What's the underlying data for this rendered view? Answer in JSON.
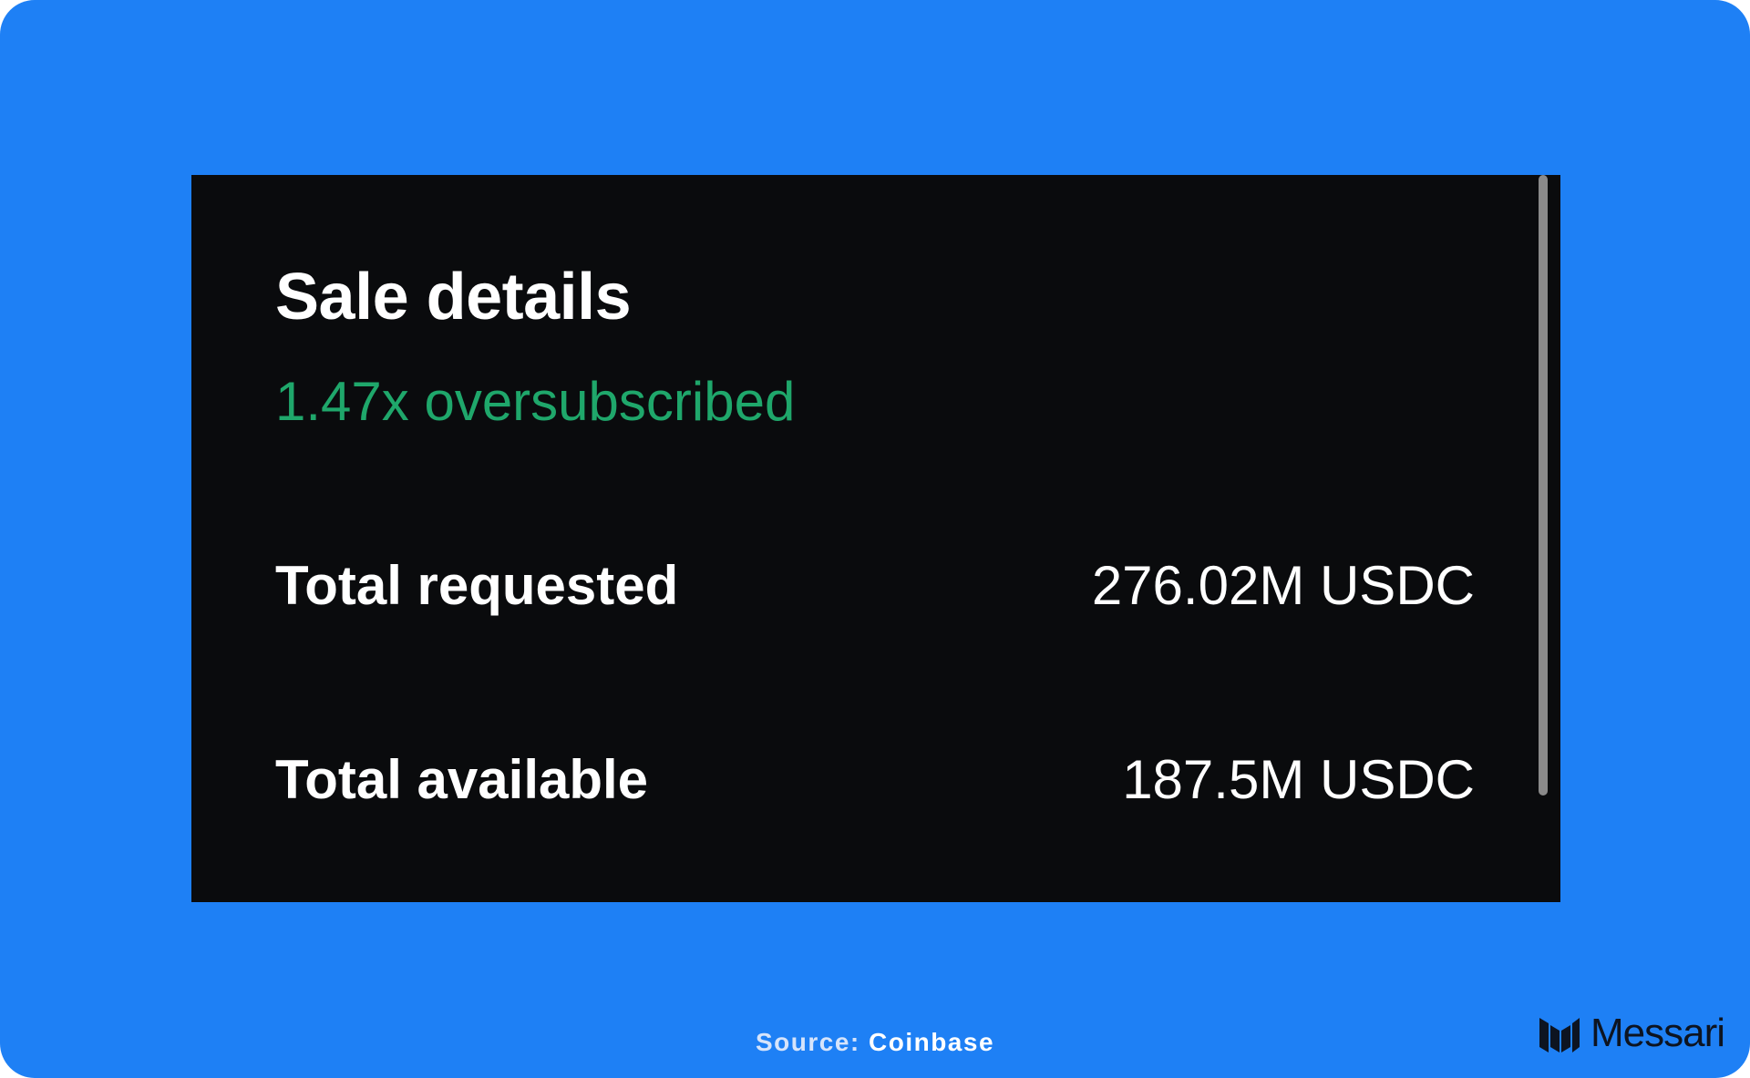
{
  "panel": {
    "title": "Sale details",
    "subtitle": "1.47x oversubscribed",
    "rows": [
      {
        "label": "Total requested",
        "value": "276.02M USDC"
      },
      {
        "label": "Total available",
        "value": "187.5M USDC"
      }
    ]
  },
  "footer": {
    "source_prefix": "Source:",
    "source_name": "Coinbase",
    "brand_name": "Messari"
  },
  "colors": {
    "background": "#1e80f5",
    "panel": "#0a0b0d",
    "accent_green": "#1fa76b",
    "text": "#ffffff",
    "brand_text": "#0d1421"
  },
  "icons": {
    "brand_logo": "messari-logo-icon",
    "scrollbar": "scrollbar-thumb"
  }
}
